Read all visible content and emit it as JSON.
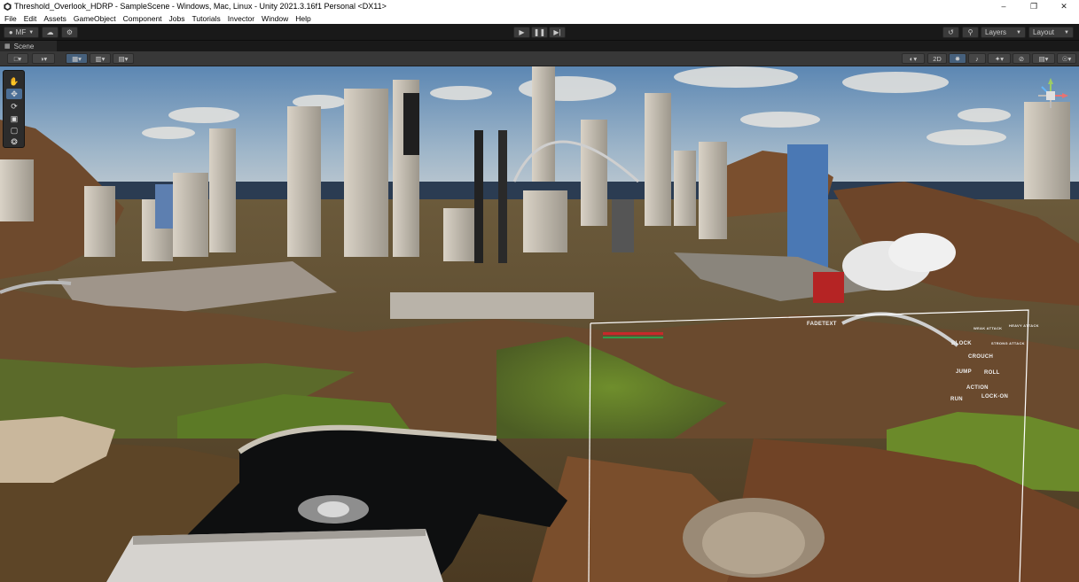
{
  "window": {
    "title": "Threshold_Overlook_HDRP - SampleScene - Windows, Mac, Linux - Unity 2021.3.16f1 Personal <DX11>",
    "minimize": "–",
    "maximize": "❐",
    "close": "✕"
  },
  "menu": [
    "File",
    "Edit",
    "Assets",
    "GameObject",
    "Component",
    "Jobs",
    "Tutorials",
    "Invector",
    "Window",
    "Help"
  ],
  "toolbar": {
    "account_label": "MF",
    "layers_label": "Layers",
    "layout_label": "Layout"
  },
  "scene_tab": {
    "label": "Scene"
  },
  "scene_toolbar": {
    "mode_2d_label": "2D"
  },
  "scene_labels": {
    "fadetext": "FADETEXT",
    "block": "BLOCK",
    "crouch": "CROUCH",
    "jump": "JUMP",
    "roll": "ROLL",
    "action": "ACTION",
    "run": "RUN",
    "lock_on": "LOCK-ON",
    "weak_attack": "WEAK ATTACK",
    "heavy_attack": "HEAVY ATTACK",
    "strong_attack": "STRONG ATTACK"
  },
  "colors": {
    "unity_dark": "#191919",
    "active_tool": "#4b6e96",
    "sky": "#7fa3c6",
    "terrain_brown": "#7a4f2e",
    "grass": "#5f7d2a",
    "water": "#0e0f10"
  }
}
